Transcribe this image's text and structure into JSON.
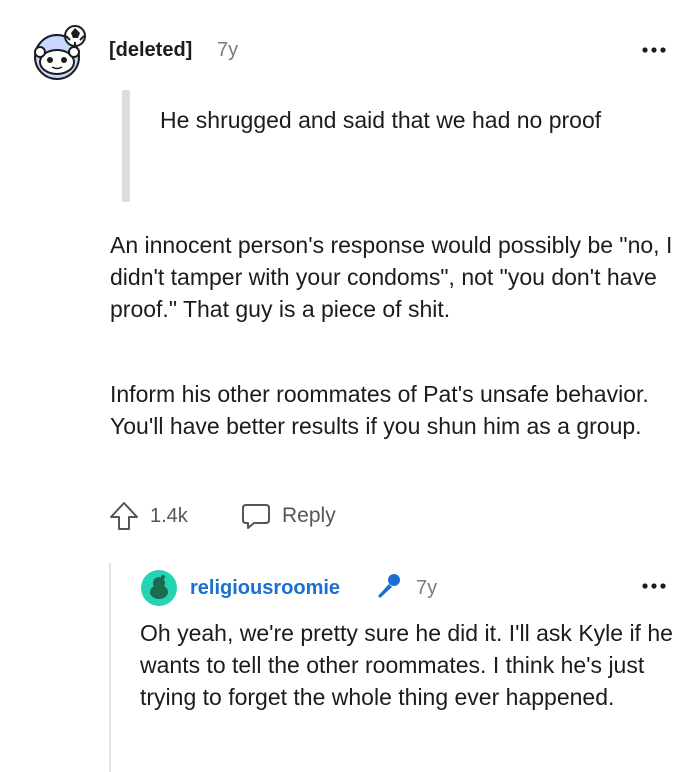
{
  "comment": {
    "username": "[deleted]",
    "age": "7y",
    "quote": "He shrugged and said that we had no proof",
    "paragraphs": [
      "An innocent person's response would possibly be \"no, I didn't tamper with your condoms\", not \"you don't have proof.\" That guy is a piece of shit.",
      "Inform his other roommates of Pat's unsafe behavior. You'll have better results if you shun him as a group."
    ],
    "upvotes": "1.4k",
    "reply_label": "Reply"
  },
  "reply": {
    "username": "religiousroomie",
    "age": "7y",
    "text": "Oh yeah, we're pretty sure he did it. I'll ask Kyle if he wants to tell the other roommates. I think he's just trying to forget the whole thing ever happened."
  },
  "colors": {
    "op_username": "#1b6fd0",
    "mic_icon": "#1b6fd0",
    "avatar2_bg": "#24d4b4"
  },
  "icons": {
    "avatar1": "snoo-deleted-avatar-icon",
    "avatar2": "snoo-avatar-icon",
    "more": "more-options-icon",
    "upvote": "upvote-arrow-icon",
    "reply": "reply-bubble-icon",
    "op_badge": "microphone-icon"
  }
}
